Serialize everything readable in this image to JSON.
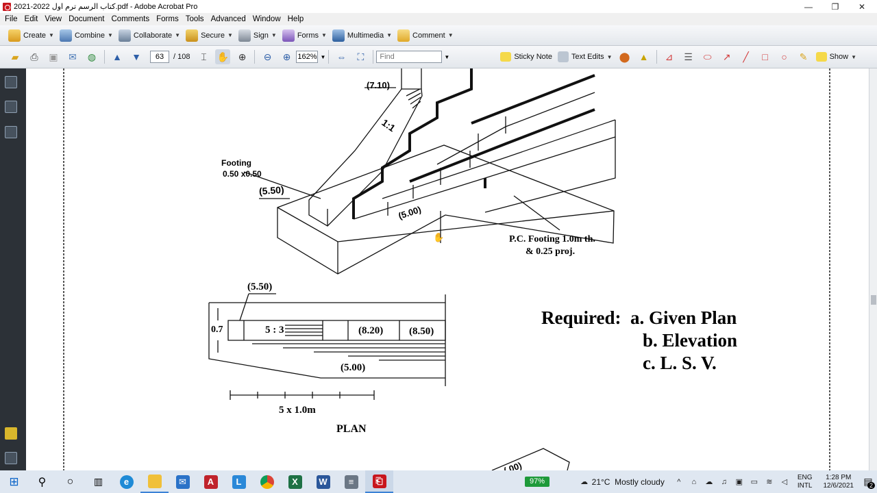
{
  "window": {
    "title": "كتاب الرسم ترم اول 2022-2021.pdf - Adobe Acrobat Pro",
    "minimize": "—",
    "maximize": "❐",
    "close": "✕"
  },
  "menubar": {
    "items": [
      "File",
      "Edit",
      "View",
      "Document",
      "Comments",
      "Forms",
      "Tools",
      "Advanced",
      "Window",
      "Help"
    ]
  },
  "toolbar1": {
    "create": "Create",
    "combine": "Combine",
    "collaborate": "Collaborate",
    "secure": "Secure",
    "sign": "Sign",
    "forms": "Forms",
    "multimedia": "Multimedia",
    "comment": "Comment"
  },
  "toolbar2": {
    "current_page": "63",
    "total_pages": "/ 108",
    "zoom": "162%",
    "find_placeholder": "Find",
    "sticky_note": "Sticky Note",
    "text_edits": "Text Edits",
    "show": "Show"
  },
  "drawing": {
    "dim_710": "(7.10)",
    "slope_11": "1:1",
    "footing_label_1": "Footing",
    "footing_label_2": "0.50 x0.50",
    "dim_550_iso": "(5.50)",
    "dim_500_iso": "(5.00)",
    "pc_footing_1": "P.C. Footing 1.0m th.",
    "pc_footing_2": "& 0.25 proj.",
    "plan_dim_550": "(5.50)",
    "plan_07": "0.7",
    "plan_ratio": "5 : 3",
    "plan_820": "(8.20)",
    "plan_850": "(8.50)",
    "plan_500": "(5.00)",
    "plan_spacing": "5 x 1.0m",
    "plan_title": "PLAN",
    "req_a": "Required:  a. Given Plan",
    "req_b": "b. Elevation",
    "req_c": "c. L. S. V.",
    "bottom_partial": "(.00)"
  },
  "taskbar": {
    "battery": "97%",
    "weather": "21°C  Mostly cloudy",
    "lang_1": "ENG",
    "lang_2": "INTL",
    "time": "1:28 PM",
    "date": "12/6/2021",
    "notifications": "2"
  },
  "colors": {
    "nav_panel": "#2c3137",
    "taskbar": "#dfe7f1",
    "battery": "#1e9a3a",
    "acrobat_red": "#c8161d"
  }
}
